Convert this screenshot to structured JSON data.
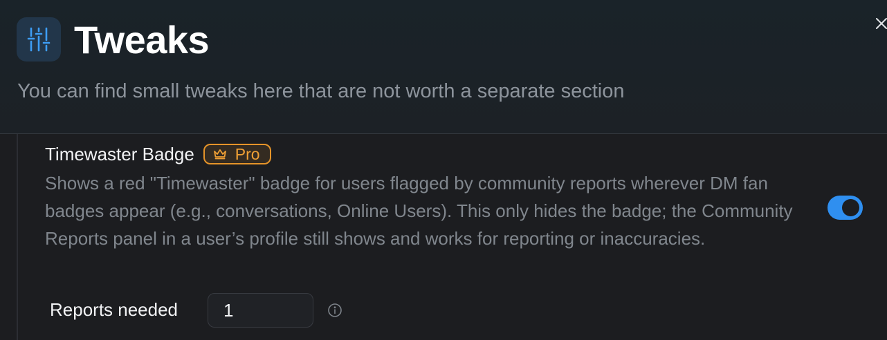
{
  "header": {
    "title": "Tweaks",
    "subtitle": "You can find small tweaks here that are not worth a separate section",
    "icon": "sliders-icon",
    "close_icon": "close-icon"
  },
  "setting": {
    "title": "Timewaster Badge",
    "badge": {
      "label": "Pro",
      "icon": "crown-icon",
      "color": "#e69429"
    },
    "description": "Shows a red \"Timewaster\" badge for users flagged by community reports wherever DM fan badges appear (e.g., conversations, Online Users). This only hides the badge; the Community Reports panel in a user’s profile still shows and works for reporting or inaccuracies.",
    "enabled": true,
    "toggle_color": "#2f8ff0",
    "reports_needed": {
      "label": "Reports needed",
      "value": "1",
      "info_icon": "info-icon"
    }
  },
  "colors": {
    "accent": "#2f8ff0",
    "pro": "#e69429"
  }
}
